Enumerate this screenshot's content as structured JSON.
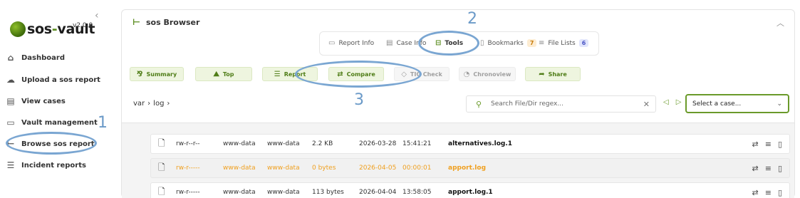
{
  "sidebar": {
    "version": "v2.0.0",
    "logo": {
      "sos": "sos",
      "dash": "-",
      "vault": "vault"
    },
    "items": [
      {
        "label": "Dashboard",
        "icon": "home-icon"
      },
      {
        "label": "Upload a sos report",
        "icon": "cloud-upload-icon"
      },
      {
        "label": "View cases",
        "icon": "cases-icon"
      },
      {
        "label": "Vault management",
        "icon": "folder-icon"
      },
      {
        "label": "Browse sos report",
        "icon": "tree-icon"
      },
      {
        "label": "Incident reports",
        "icon": "list-icon"
      }
    ]
  },
  "panel": {
    "title": "sos Browser",
    "tabs": [
      {
        "label": "Report Info",
        "icon": "report-icon"
      },
      {
        "label": "Case Info",
        "icon": "case-icon"
      },
      {
        "label": "Tools",
        "icon": "toolbox-icon",
        "active": true
      },
      {
        "label": "Bookmarks",
        "icon": "bookmark-icon",
        "badge": "7"
      },
      {
        "label": "File Lists",
        "icon": "file-list-icon",
        "badge": "6"
      }
    ],
    "actions": [
      {
        "label": "Summary",
        "icon": "summary-icon",
        "enabled": true
      },
      {
        "label": "Top",
        "icon": "chart-icon",
        "enabled": true
      },
      {
        "label": "Report",
        "icon": "report-list-icon",
        "enabled": true
      },
      {
        "label": "Compare",
        "icon": "compare-icon",
        "enabled": true
      },
      {
        "label": "TIG Check",
        "icon": "tig-icon",
        "enabled": false
      },
      {
        "label": "Chronoview",
        "icon": "clock-icon",
        "enabled": false
      },
      {
        "label": "Share",
        "icon": "share-icon",
        "enabled": true
      }
    ],
    "breadcrumb": [
      "var",
      "log"
    ],
    "search": {
      "placeholder": "Search File/Dir regex..."
    },
    "case_select": {
      "value": "Select a case..."
    }
  },
  "files": [
    {
      "perms": "rw-r--r--",
      "owner": "www-data",
      "group": "www-data",
      "size": "2.2 KB",
      "date": "2026-03-28",
      "time": "15:41:21",
      "name": "alternatives.log.1",
      "style": "normal"
    },
    {
      "perms": "rw-r-----",
      "owner": "www-data",
      "group": "www-data",
      "size": "0 bytes",
      "date": "2026-04-05",
      "time": "00:00:01",
      "name": "apport.log",
      "style": "warn"
    },
    {
      "perms": "rw-r-----",
      "owner": "www-data",
      "group": "www-data",
      "size": "113 bytes",
      "date": "2026-04-04",
      "time": "13:58:05",
      "name": "apport.log.1",
      "style": "normal"
    }
  ],
  "annotations": {
    "one": "1",
    "two": "2",
    "three": "3"
  },
  "colors": {
    "accent": "#5a8c1e",
    "warn": "#f0a020",
    "annotation": "#7aa6d2"
  }
}
